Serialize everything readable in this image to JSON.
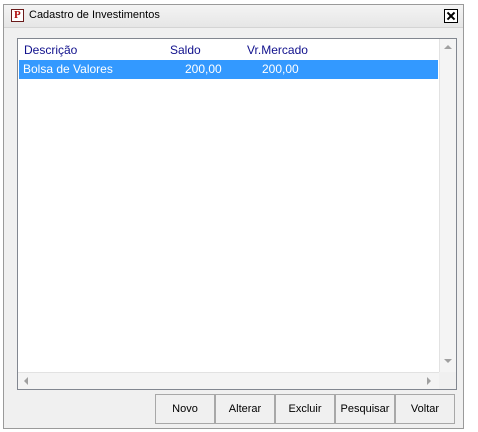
{
  "window": {
    "title": "Cadastro de Investimentos"
  },
  "table": {
    "columns": [
      "Descrição",
      "Saldo",
      "Vr.Mercado"
    ],
    "rows": [
      {
        "descricao": "Bolsa de Valores",
        "saldo": "200,00",
        "vr_mercado": "200,00",
        "selected": true
      }
    ]
  },
  "buttons": {
    "novo": "Novo",
    "alterar": "Alterar",
    "excluir": "Excluir",
    "pesquisar": "Pesquisar",
    "voltar": "Voltar"
  },
  "colors": {
    "selection": "#3399ff",
    "header_text": "#10108c"
  }
}
